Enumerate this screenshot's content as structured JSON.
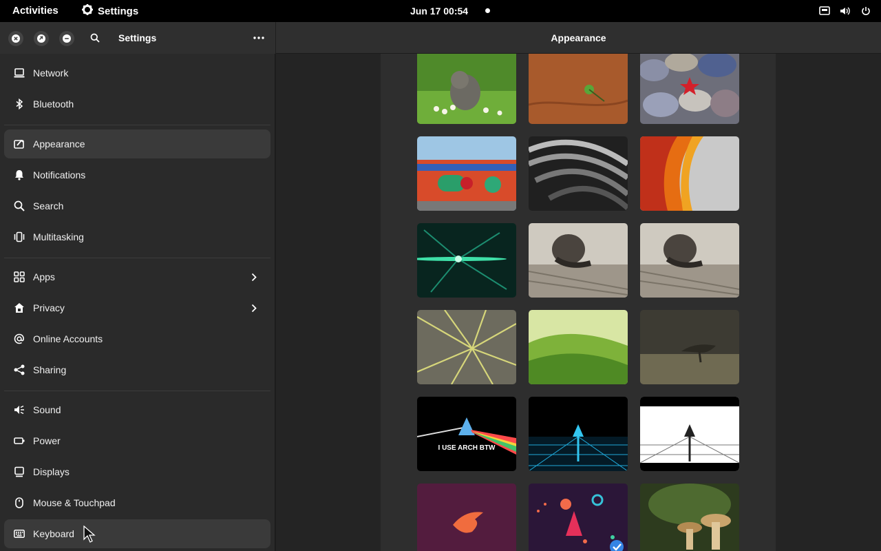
{
  "topbar": {
    "activities": "Activities",
    "app_name": "Settings",
    "clock": "Jun 17  00:54",
    "tray_icons": [
      "network-wired-icon",
      "volume-icon",
      "power-icon"
    ]
  },
  "sidebar": {
    "title": "Settings",
    "items": [
      {
        "label": "Network",
        "icon": "network-icon"
      },
      {
        "label": "Bluetooth",
        "icon": "bluetooth-icon"
      },
      {
        "label": "Appearance",
        "icon": "appearance-icon",
        "active": true
      },
      {
        "label": "Notifications",
        "icon": "bell-icon"
      },
      {
        "label": "Search",
        "icon": "search-icon"
      },
      {
        "label": "Multitasking",
        "icon": "multitasking-icon"
      },
      {
        "label": "Apps",
        "icon": "apps-grid-icon",
        "submenu": true
      },
      {
        "label": "Privacy",
        "icon": "privacy-hand-icon",
        "submenu": true
      },
      {
        "label": "Online Accounts",
        "icon": "at-sign-icon"
      },
      {
        "label": "Sharing",
        "icon": "share-icon"
      },
      {
        "label": "Sound",
        "icon": "speaker-icon"
      },
      {
        "label": "Power",
        "icon": "battery-icon"
      },
      {
        "label": "Displays",
        "icon": "display-icon"
      },
      {
        "label": "Mouse & Touchpad",
        "icon": "mouse-icon"
      },
      {
        "label": "Keyboard",
        "icon": "keyboard-icon"
      }
    ]
  },
  "main": {
    "title": "Appearance",
    "wallpapers": [
      {
        "name": "kitten-in-grass",
        "text": ""
      },
      {
        "name": "rust-orange-plant",
        "text": ""
      },
      {
        "name": "pebbles-red-star",
        "text": ""
      },
      {
        "name": "colorful-mural-wall",
        "text": ""
      },
      {
        "name": "bw-spiral-architecture",
        "text": ""
      },
      {
        "name": "orange-waves-abstract",
        "text": ""
      },
      {
        "name": "teal-light-burst",
        "text": ""
      },
      {
        "name": "snail-on-wood",
        "text": ""
      },
      {
        "name": "snail-on-wood-2",
        "text": ""
      },
      {
        "name": "lily-pad-veins",
        "text": ""
      },
      {
        "name": "green-tea-hills",
        "text": ""
      },
      {
        "name": "tree-in-storm-field",
        "text": ""
      },
      {
        "name": "arch-prism-dark",
        "text": "I USE ARCH BTW"
      },
      {
        "name": "arch-synthwave-road",
        "text": ""
      },
      {
        "name": "arch-white-road",
        "text": ""
      },
      {
        "name": "purple-bird-logo",
        "text": ""
      },
      {
        "name": "space-rocket-planets",
        "text": "",
        "selected": true
      },
      {
        "name": "mushrooms-forest",
        "text": ""
      }
    ]
  },
  "colors": {
    "topbar_bg": "#000000",
    "sidebar_bg": "#2a2a2a",
    "active_row": "#3a3a3a",
    "main_bg": "#242424",
    "panel_bg": "#2e2e2e",
    "accent": "#3584e4"
  }
}
